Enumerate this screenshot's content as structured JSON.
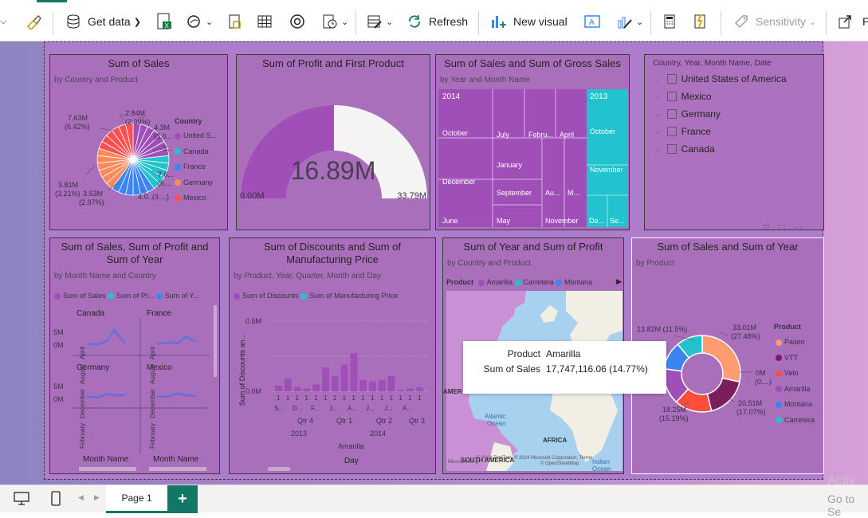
{
  "ribbon": {
    "get_data": "Get data",
    "refresh": "Refresh",
    "new_visual": "New visual",
    "sensitivity": "Sensitivity",
    "publish_partial": "P"
  },
  "visuals": {
    "pie": {
      "title": "Sum of Sales",
      "subtitle": "by Country and Product",
      "legend_title": "Country",
      "legend": [
        "United S...",
        "Canada",
        "France",
        "Germany",
        "Mexico"
      ],
      "labels": [
        "7.63M",
        "(6.42%)",
        "2.84M",
        "(2.39%)",
        "4.3M",
        "(3.6...",
        "3...",
        "7.6...",
        "(6....",
        "3.81M",
        "(3.21%)",
        "3.53M",
        "(2.97%)",
        "4.0...",
        "(3....)"
      ]
    },
    "gauge": {
      "title": "Sum of Profit and First Product",
      "value_label": "16.89M",
      "min_label": "0.00M",
      "max_label": "33.79M",
      "value": 16.89,
      "max": 33.79
    },
    "treemap": {
      "title": "Sum of Sales and Sum of Gross Sales",
      "subtitle": "by Year and Month Name",
      "labels": [
        "2014",
        "October",
        "July",
        "Febru...",
        "April",
        "December",
        "January",
        "June",
        "September",
        "Au...",
        "M...",
        "May",
        "November",
        "2013",
        "October",
        "November",
        "De...",
        "Se..."
      ]
    },
    "slicer": {
      "header": "Country, Year, Month Name, Date",
      "items": [
        "United States of America",
        "Mexico",
        "Germany",
        "France",
        "Canada"
      ]
    },
    "small_multiples": {
      "title": "Sum of Sales, Sum of Profit and Sum of Year",
      "subtitle": "by Month Name and Country",
      "legend": [
        "Sum of Sales",
        "Sum of Pr...",
        "Sum of Y..."
      ],
      "panels": [
        "Canada",
        "France",
        "Germany",
        "Mexico"
      ],
      "y_ticks": [
        "5M",
        "0M"
      ],
      "x_ticks": [
        "April",
        "August",
        "December",
        "February"
      ],
      "x_title": "Month Name"
    },
    "column": {
      "title": "Sum of Discounts and Sum of Manufacturing Price",
      "subtitle": "by Product, Year, Quarter, Month and Day",
      "legend": [
        "Sum of Discounts",
        "Sum of Manufacturing Price"
      ],
      "y_title": "Sum of Discounts an...",
      "y_ticks": [
        "0.5M",
        "0.0M"
      ],
      "quarters": [
        "Qtr 4",
        "Qtr 1",
        "Qtr 2",
        "Qtr 3"
      ],
      "years": [
        "2013",
        "2014"
      ],
      "product": "Amarilla",
      "x_title": "Day",
      "bar_labels": [
        "1",
        "1",
        "1",
        "1",
        "1",
        "1",
        "1",
        "1",
        "1",
        "1",
        "1",
        "1",
        "1",
        "1",
        "1",
        "1"
      ],
      "sub_labels": [
        "S...",
        "D...",
        "F...",
        "J...",
        "A...",
        "J...",
        "J...",
        "A..."
      ],
      "values": [
        0.04,
        0.09,
        0.03,
        0.02,
        0.05,
        0.17,
        0.11,
        0.19,
        0.27,
        0.08,
        0.07,
        0.08,
        0.11,
        0.01,
        0.02,
        0.03
      ]
    },
    "map": {
      "title": "Sum of Year and Sum of Profit",
      "subtitle": "by Country and Product",
      "legend_title": "Product",
      "legend": [
        "Amarilla",
        "Carretera",
        "Montana"
      ],
      "labels": [
        "AMER",
        "Atlantic",
        "Ocean",
        "AFRICA",
        "SOUTH AMERICA",
        "Indian",
        "Ocean"
      ],
      "credits": "© 2024 TomTom, © 2024 Microsoft Corporation, Terms",
      "credits2": "© OpenStreetMap",
      "bing": "Microsoft Bing"
    },
    "tooltip": {
      "k1": "Product",
      "v1": "Amarilla",
      "k2": "Sum of Sales",
      "v2": "17,747,116.06 (14.77%)"
    },
    "donut": {
      "title": "Sum of Sales and Sum of Year",
      "subtitle": "by Product",
      "legend_title": "Product",
      "legend": [
        "Paseo",
        "VTT",
        "Velo",
        "Amarilla",
        "Montana",
        "Carretera"
      ],
      "labels": [
        "13.82M (11.5%)",
        "33.01M",
        "(27.48%)",
        "0M",
        "(0....)",
        "20.51M",
        "(17.07%)",
        "18.25M",
        "(15.19%)"
      ],
      "values": [
        33.01,
        20.51,
        18.25,
        17.75,
        13.82,
        12.8
      ]
    }
  },
  "bottom": {
    "page_tab": "Page 1",
    "add": "+",
    "watermark1": "Activ",
    "watermark2": "Go to Se"
  },
  "colors": {
    "united_states": "#a04fb9",
    "canada": "#22c2ce",
    "france": "#3b85f3",
    "germany": "#ff8a5b",
    "mexico": "#fc5151",
    "paseo": "#ff9c73",
    "vtt": "#7b1e5d",
    "velo": "#ff4d3d",
    "amarilla": "#a04fb9",
    "montana": "#3b85f3",
    "carretera": "#22c2ce",
    "accent": "#117865"
  }
}
